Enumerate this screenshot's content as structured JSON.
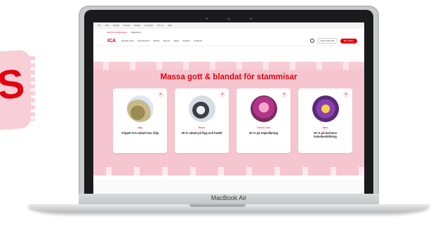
{
  "side_text": "S",
  "laptop": {
    "brand_label": "MacBook Air"
  },
  "site": {
    "topbar_links": [
      "ICA",
      "Jobb",
      "Nyheter",
      "Kontakt",
      "Företag",
      "Leverantör",
      "För oss",
      "Hjälp"
    ],
    "promo": {
      "text": "Ett ICA-medlemskap ... ",
      "link": "Registrera"
    },
    "logo": "ICA",
    "nav": [
      "Handla online",
      "Erbjudanden",
      "Butiker",
      "Recept",
      "Hälsa",
      "Spelkort",
      "Lokalmat"
    ],
    "store_selector": "Ingen butik vald",
    "cta": "Bli medlem",
    "hero_title": "Massa gott & blandat för stammisar",
    "cards": [
      {
        "category": "Vilja",
        "description": "Trippel ICA-rabatt hos Vilja"
      },
      {
        "category": "Resor",
        "description": "25 % rabatt på flyg och hotell"
      },
      {
        "category": "Gröna Lund",
        "description": "20 % på nöjesåkning"
      },
      {
        "category": "Barn",
        "description": "20 % på barnens kalasbeställning"
      }
    ]
  },
  "colors": {
    "brand_red": "#e3000f",
    "hero_pink": "#f6c6d0"
  }
}
